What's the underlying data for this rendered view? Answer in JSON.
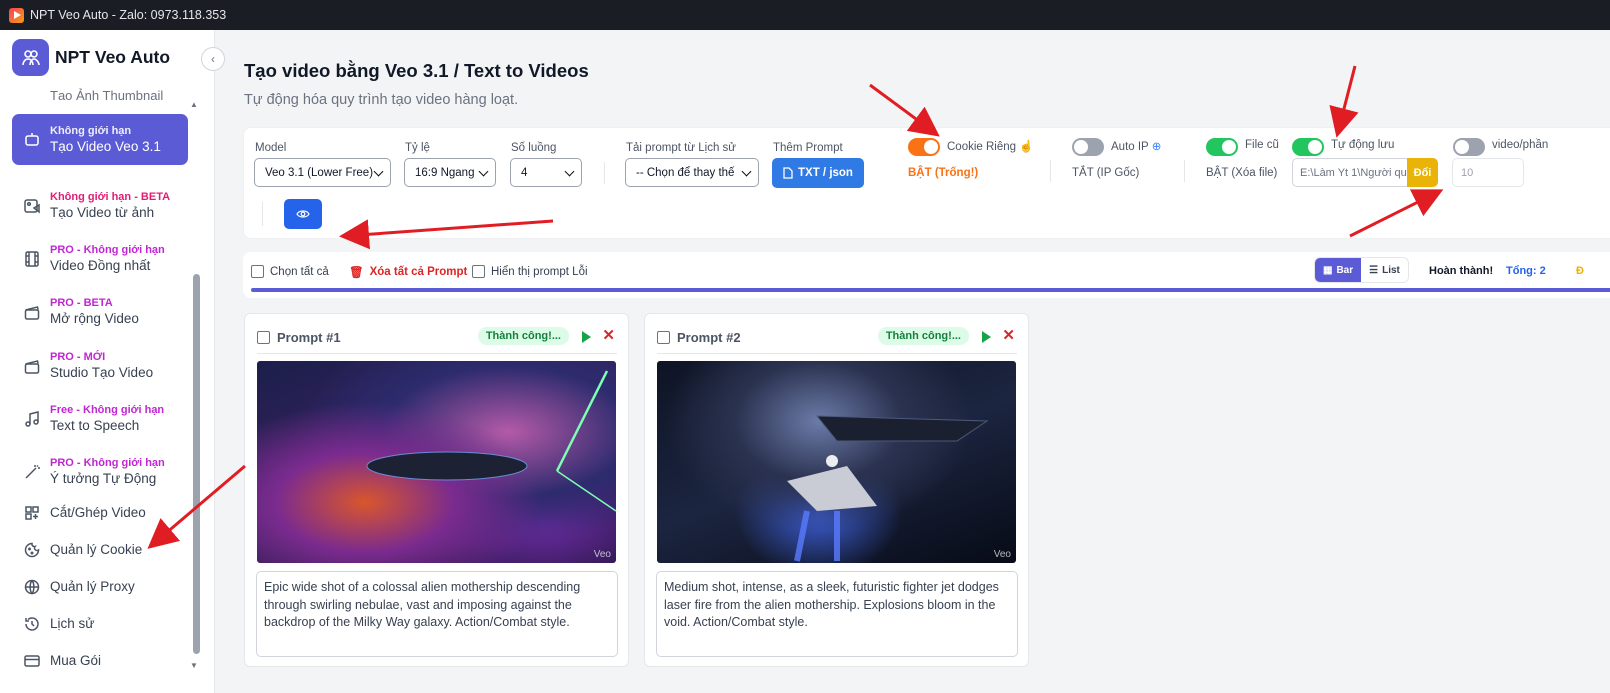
{
  "window": {
    "title": "NPT Veo Auto - Zalo: 0973.118.353"
  },
  "brand": {
    "name": "NPT Veo Auto"
  },
  "sidebar": {
    "partial_label": "Tạo Ảnh Thumbnail",
    "items": [
      {
        "tag": "Không giới hạn",
        "label": "Tạo Video Veo 3.1",
        "icon": "robot-icon",
        "tag_color": "#ffffff",
        "active": true
      },
      {
        "tag": "Không giới hạn - BETA",
        "label": "Tạo Video từ ảnh",
        "icon": "image-video-icon",
        "tag_color": "#e11d74"
      },
      {
        "tag": "PRO - Không giới hạn",
        "label": "Video Đồng nhất",
        "icon": "film-icon",
        "tag_color": "#c026d3"
      },
      {
        "tag": "PRO - BETA",
        "label": "Mở rộng Video",
        "icon": "clapperboard-icon",
        "tag_color": "#c026d3"
      },
      {
        "tag": "PRO - MỚI",
        "label": "Studio Tạo Video",
        "icon": "clapperboard-icon",
        "tag_color": "#c026d3"
      },
      {
        "tag": "Free - Không giới hạn",
        "label": "Text to Speech",
        "icon": "music-icon",
        "tag_color": "#c026d3"
      },
      {
        "tag": "PRO - Không giới hạn",
        "label": "Ý tưởng Tự Động",
        "icon": "magic-wand-icon",
        "tag_color": "#c026d3"
      },
      {
        "tag": "",
        "label": "Cắt/Ghép Video",
        "icon": "grid-icon"
      },
      {
        "tag": "",
        "label": "Quản lý Cookie",
        "icon": "cookie-icon"
      },
      {
        "tag": "",
        "label": "Quản lý Proxy",
        "icon": "globe-icon"
      },
      {
        "tag": "",
        "label": "Lịch sử",
        "icon": "history-icon"
      },
      {
        "tag": "",
        "label": "Mua Gói",
        "icon": "card-icon"
      }
    ]
  },
  "header": {
    "title": "Tạo video bằng Veo 3.1 / Text to Videos",
    "subtitle": "Tự động hóa quy trình tạo video hàng loạt."
  },
  "settings": {
    "model_label": "Model",
    "model_value": "Veo 3.1 (Lower Free)",
    "ratio_label": "Tỷ lệ",
    "ratio_value": "16:9 Ngang",
    "threads_label": "Số luồng",
    "threads_value": "4",
    "history_label": "Tải prompt từ Lịch sử",
    "history_value": "-- Chọn để thay thế",
    "add_prompt_label": "Thêm Prompt",
    "add_prompt_button": "TXT / json",
    "cookie_label": "Cookie Riêng",
    "cookie_status": "BẬT (Trống!)",
    "cookie_on": true,
    "autoip_label": "Auto IP",
    "autoip_status": "TẮT (IP Gốc)",
    "autoip_on": false,
    "oldfile_label": "File cũ",
    "oldfile_status": "BẬT (Xóa file)",
    "oldfile_on": true,
    "autosave_label": "Tự động lưu",
    "autosave_on": true,
    "save_path": "E:\\Làm Yt 1\\Người qu",
    "change_button": "Đổi",
    "video_per_label": "video/phần",
    "video_per_on": false,
    "video_per_value": "10",
    "colors": {
      "accent": "#5b5bd6",
      "orange": "#f97316",
      "green": "#22c55e",
      "blue": "#2f7ae5",
      "gold": "#eab308"
    }
  },
  "toolbar": {
    "select_all": "Chọn tất cả",
    "delete_all": "Xóa tất cả Prompt",
    "show_errors": "Hiển thị prompt Lỗi",
    "view_bar": "Bar",
    "view_list": "List",
    "done_label": "Hoàn thành!",
    "total_label": "Tổng: 2",
    "cut_label": "Đ",
    "progress": 1.0
  },
  "prompts": [
    {
      "title": "Prompt #1",
      "status": "Thành công!...",
      "watermark": "Veo",
      "text": "Epic wide shot of a colossal alien mothership descending through swirling nebulae, vast and imposing against the backdrop of the Milky Way galaxy. Action/Combat style."
    },
    {
      "title": "Prompt #2",
      "status": "Thành công!...",
      "watermark": "Veo",
      "text": "Medium shot, intense, as a sleek, futuristic fighter jet dodges laser fire from the alien mothership. Explosions bloom in the void. Action/Combat style."
    }
  ]
}
